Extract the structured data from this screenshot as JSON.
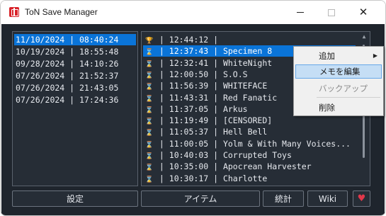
{
  "window": {
    "title": "ToN Save Manager",
    "accent": "#0a74d8",
    "background": "#1f252d"
  },
  "dates": [
    {
      "text": "11/10/2024 | 08:40:24",
      "selected": true
    },
    {
      "text": "10/19/2024 | 18:55:48",
      "selected": false
    },
    {
      "text": "09/28/2024 | 14:10:26",
      "selected": false
    },
    {
      "text": "07/26/2024 | 21:52:37",
      "selected": false
    },
    {
      "text": "07/26/2024 | 21:43:05",
      "selected": false
    },
    {
      "text": "07/26/2024 | 17:24:36",
      "selected": false
    }
  ],
  "sessions": [
    {
      "icon": "trophy-icon",
      "glyph": "🏆",
      "time": "12:44:12",
      "name": "",
      "selected": false
    },
    {
      "icon": "hourglass-icon",
      "glyph": "⌛",
      "time": "12:37:43",
      "name": "Specimen 8",
      "selected": true
    },
    {
      "icon": "hourglass-icon",
      "glyph": "⌛",
      "time": "12:32:41",
      "name": "WhiteNight",
      "selected": false
    },
    {
      "icon": "hourglass-icon",
      "glyph": "⌛",
      "time": "12:00:50",
      "name": "S.O.S",
      "selected": false
    },
    {
      "icon": "hourglass-icon",
      "glyph": "⌛",
      "time": "11:56:39",
      "name": "WHITEFACE",
      "selected": false
    },
    {
      "icon": "hourglass-icon",
      "glyph": "⌛",
      "time": "11:43:31",
      "name": "Red Fanatic",
      "selected": false
    },
    {
      "icon": "hourglass-icon",
      "glyph": "⌛",
      "time": "11:37:05",
      "name": "Arkus",
      "selected": false
    },
    {
      "icon": "hourglass-icon",
      "glyph": "⌛",
      "time": "11:19:49",
      "name": "[CENSORED]",
      "selected": false
    },
    {
      "icon": "hourglass-icon",
      "glyph": "⌛",
      "time": "11:05:37",
      "name": "Hell Bell",
      "selected": false
    },
    {
      "icon": "hourglass-icon",
      "glyph": "⌛",
      "time": "11:00:05",
      "name": "Yolm & With Many Voices...",
      "selected": false
    },
    {
      "icon": "hourglass-icon",
      "glyph": "⌛",
      "time": "10:40:03",
      "name": "Corrupted Toys",
      "selected": false
    },
    {
      "icon": "hourglass-icon",
      "glyph": "⌛",
      "time": "10:35:00",
      "name": "Apocrean Harvester",
      "selected": false
    },
    {
      "icon": "hourglass-icon",
      "glyph": "⌛",
      "time": "10:30:17",
      "name": "Charlotte",
      "selected": false
    }
  ],
  "buttons": {
    "settings": "設定",
    "items": "アイテム",
    "stats": "統計",
    "wiki": "Wiki",
    "heart": "♥"
  },
  "context_menu": {
    "add": "追加",
    "edit_memo": "メモを編集",
    "backup": "バックアップ",
    "delete": "削除"
  }
}
